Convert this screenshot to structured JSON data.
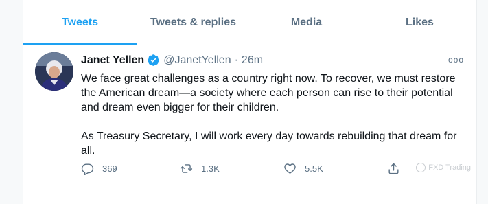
{
  "tabs": [
    {
      "label": "Tweets",
      "active": true
    },
    {
      "label": "Tweets & replies",
      "active": false
    },
    {
      "label": "Media",
      "active": false
    },
    {
      "label": "Likes",
      "active": false
    }
  ],
  "tweet": {
    "author_name": "Janet Yellen",
    "verified": true,
    "handle": "@JanetYellen",
    "separator": "·",
    "time": "26m",
    "paragraphs": [
      "We face great challenges as a country right now. To recover, we must restore the American dream—a society where each person can rise to their potential and dream even bigger for their children.",
      "As Treasury Secretary, I will work every day towards rebuilding that dream for all."
    ],
    "more_label": "ooo",
    "stats": {
      "replies": "369",
      "retweets": "1.3K",
      "likes": "5.5K"
    }
  },
  "watermark": "FXD Trading",
  "colors": {
    "accent": "#1da1f2",
    "secondary_text": "#5b7083",
    "primary_text": "#0f1419",
    "border": "#ebeef0"
  },
  "icons": {
    "verified": "verified-badge-icon",
    "reply": "reply-icon",
    "retweet": "retweet-icon",
    "like": "heart-icon",
    "share": "share-icon",
    "more": "more-options-icon"
  }
}
